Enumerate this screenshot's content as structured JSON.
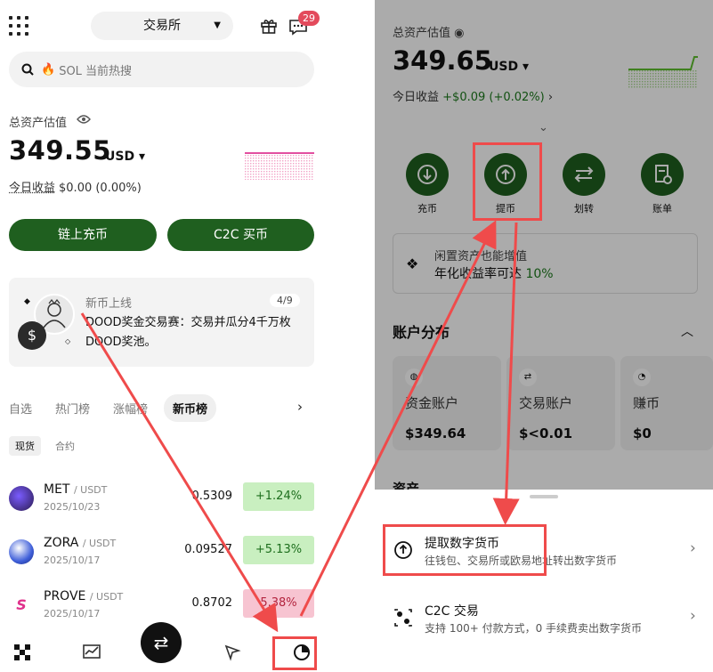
{
  "left": {
    "exchange": "交易所",
    "notification_count": "29",
    "search_placeholder": "SOL 当前热搜",
    "asset_label": "总资产估值",
    "asset_value": "349.55",
    "asset_unit": "USD",
    "pnl_label": "今日收益",
    "pnl_value": "$0.00 (0.00%)",
    "btn_onchain": "链上充币",
    "btn_c2c": "C2C 买币",
    "promo": {
      "title": "新币上线",
      "page": "4/9",
      "text": "DOOD奖金交易赛：交易并瓜分4千万枚DOOD奖池。"
    },
    "tabs": [
      "自选",
      "热门榜",
      "涨幅榜",
      "新币榜"
    ],
    "subtabs": [
      "现货",
      "合约"
    ],
    "rows": [
      {
        "symbol": "MET",
        "quote": "/ USDT",
        "date": "2025/10/23",
        "price": "0.5309",
        "change": "+1.24%",
        "dir": "up",
        "color": "#3a2a6e"
      },
      {
        "symbol": "ZORA",
        "quote": "/ USDT",
        "date": "2025/10/17",
        "price": "0.09527",
        "change": "+5.13%",
        "dir": "up",
        "color": "#3f5fd9"
      },
      {
        "symbol": "PROVE",
        "quote": "/ USDT",
        "date": "2025/10/17",
        "price": "0.8702",
        "change": "5.38%",
        "dir": "down",
        "color": "#e0318c"
      }
    ]
  },
  "right": {
    "asset_label": "总资产估值",
    "asset_value": "349.65",
    "asset_unit": "USD",
    "pnl_label": "今日收益",
    "pnl_value": "+$0.09 (+0.02%)",
    "actions": [
      {
        "label": "充币",
        "icon": "deposit-icon"
      },
      {
        "label": "提币",
        "icon": "withdraw-icon"
      },
      {
        "label": "划转",
        "icon": "transfer-icon"
      },
      {
        "label": "账单",
        "icon": "bill-icon"
      }
    ],
    "idle": {
      "line1": "闲置资产也能增值",
      "line2_prefix": "年化收益率可达 ",
      "line2_rate": "10%"
    },
    "distribution_title": "账户分布",
    "accounts": [
      {
        "name": "资金账户",
        "value": "$349.64"
      },
      {
        "name": "交易账户",
        "value": "$<0.01"
      },
      {
        "name": "赚币",
        "value": "$0"
      }
    ],
    "assets_peek": "资产",
    "sheet": [
      {
        "title": "提取数字货币",
        "subtitle": "往钱包、交易所或欧易地址转出数字货币"
      },
      {
        "title": "C2C 交易",
        "subtitle": "支持 100+ 付款方式，0 手续费卖出数字货币"
      }
    ]
  },
  "colors": {
    "accent": "#1f5f1f",
    "annotation": "#ef4b4b",
    "up": "#1d6e1d",
    "down": "#b3243e"
  }
}
